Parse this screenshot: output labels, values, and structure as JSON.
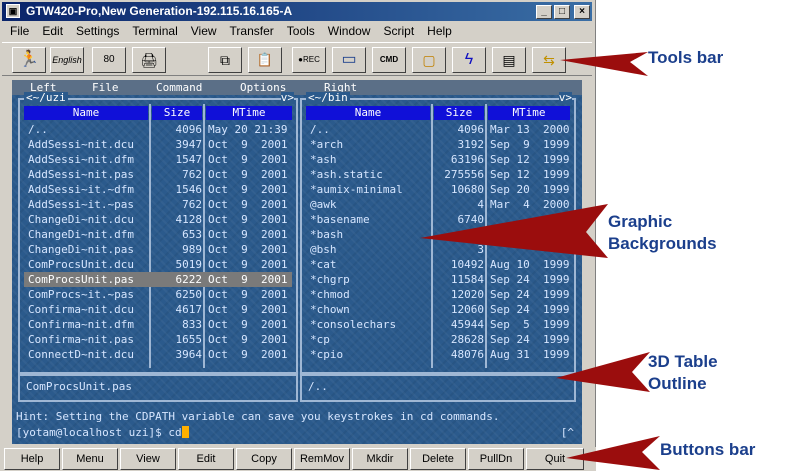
{
  "window": {
    "title": "GTW420-Pro,New Generation-192.115.16.165-A",
    "controls": [
      "_",
      "□",
      "×"
    ]
  },
  "menubar": [
    "File",
    "Edit",
    "Settings",
    "Terminal",
    "View",
    "Transfer",
    "Tools",
    "Window",
    "Script",
    "Help"
  ],
  "toolbar": {
    "buttons": [
      {
        "icon": "run-icon",
        "label": "🏃"
      },
      {
        "icon": "english-icon",
        "label": "English"
      },
      {
        "icon": "screen-size-icon",
        "label": "80"
      },
      {
        "icon": "print-icon",
        "label": "🖨"
      },
      {
        "icon": "copy-icon",
        "label": "⧉"
      },
      {
        "icon": "paste-icon",
        "label": "📋"
      },
      {
        "icon": "record-icon",
        "label": "●REC"
      },
      {
        "icon": "monitor-icon",
        "label": "▭"
      },
      {
        "icon": "cmd-icon",
        "label": "CMD"
      },
      {
        "icon": "screen-icon",
        "label": "▢"
      },
      {
        "icon": "lightning-icon",
        "label": "ϟ"
      },
      {
        "icon": "modem-icon",
        "label": "▤"
      },
      {
        "icon": "network-icon",
        "label": "⇆"
      }
    ]
  },
  "terminal": {
    "menu": [
      "Left",
      "File",
      "Command",
      "Options",
      "Right"
    ],
    "left_panel": {
      "path": "~/uzi",
      "headers": [
        "Name",
        "Size",
        "MTime"
      ],
      "rows": [
        [
          "/..",
          "4096",
          "May 20 21:39"
        ],
        [
          "AddSessi~nit.dcu",
          "3947",
          "Oct  9  2001"
        ],
        [
          "AddSessi~nit.dfm",
          "1547",
          "Oct  9  2001"
        ],
        [
          "AddSessi~nit.pas",
          "762",
          "Oct  9  2001"
        ],
        [
          "AddSessi~it.~dfm",
          "1546",
          "Oct  9  2001"
        ],
        [
          "AddSessi~it.~pas",
          "762",
          "Oct  9  2001"
        ],
        [
          "ChangeDi~nit.dcu",
          "4128",
          "Oct  9  2001"
        ],
        [
          "ChangeDi~nit.dfm",
          "653",
          "Oct  9  2001"
        ],
        [
          "ChangeDi~nit.pas",
          "989",
          "Oct  9  2001"
        ],
        [
          "ComProcsUnit.dcu",
          "5019",
          "Oct  9  2001"
        ],
        [
          "ComProcsUnit.pas",
          "6222",
          "Oct  9  2001"
        ],
        [
          "ComProcs~it.~pas",
          "6250",
          "Oct  9  2001"
        ],
        [
          "Confirma~nit.dcu",
          "4617",
          "Oct  9  2001"
        ],
        [
          "Confirma~nit.dfm",
          "833",
          "Oct  9  2001"
        ],
        [
          "Confirma~nit.pas",
          "1655",
          "Oct  9  2001"
        ],
        [
          "ConnectD~nit.dcu",
          "3964",
          "Oct  9  2001"
        ]
      ],
      "selected_index": 10,
      "status": "ComProcsUnit.pas"
    },
    "right_panel": {
      "path": "~/bin",
      "headers": [
        "Name",
        "Size",
        "MTime"
      ],
      "rows": [
        [
          "/..",
          "4096",
          "Mar 13  2000"
        ],
        [
          "*arch",
          "3192",
          "Sep  9  1999"
        ],
        [
          "*ash",
          "63196",
          "Sep 12  1999"
        ],
        [
          "*ash.static",
          "275556",
          "Sep 12  1999"
        ],
        [
          "*aumix-minimal",
          "10680",
          "Sep 20  1999"
        ],
        [
          "@awk",
          "4",
          "Mar  4  2000"
        ],
        [
          "*basename",
          "6740",
          ""
        ],
        [
          "*bash",
          "",
          ""
        ],
        [
          "@bsh",
          "3",
          ""
        ],
        [
          "*cat",
          "10492",
          "Aug 10  1999"
        ],
        [
          "*chgrp",
          "11584",
          "Sep 24  1999"
        ],
        [
          "*chmod",
          "12020",
          "Sep 24  1999"
        ],
        [
          "*chown",
          "12060",
          "Sep 24  1999"
        ],
        [
          "*consolechars",
          "45944",
          "Sep  5  1999"
        ],
        [
          "*cp",
          "28628",
          "Sep 24  1999"
        ],
        [
          "*cpio",
          "48076",
          "Aug 31  1999"
        ]
      ],
      "status": "/.."
    },
    "hint": "Hint: Setting the CDPATH variable can save you keystrokes in cd commands.",
    "prompt": "[yotam@localhost uzi]$ cd",
    "corner": "[^"
  },
  "buttonbar": [
    "Help",
    "Menu",
    "View",
    "Edit",
    "Copy",
    "RemMov",
    "Mkdir",
    "Delete",
    "PullDn",
    "Quit"
  ],
  "callouts": {
    "tools_bar": "Tools bar",
    "graphic_backgrounds_1": "Graphic",
    "graphic_backgrounds_2": "Backgrounds",
    "table_outline_1": "3D Table",
    "table_outline_2": "Outline",
    "buttons_bar": "Buttons bar"
  },
  "colors": {
    "accent": "#1b3f8c",
    "arrow": "#9b0d0d",
    "terminal_bg": "#2b5a8c",
    "header_bg": "#1010d8"
  }
}
